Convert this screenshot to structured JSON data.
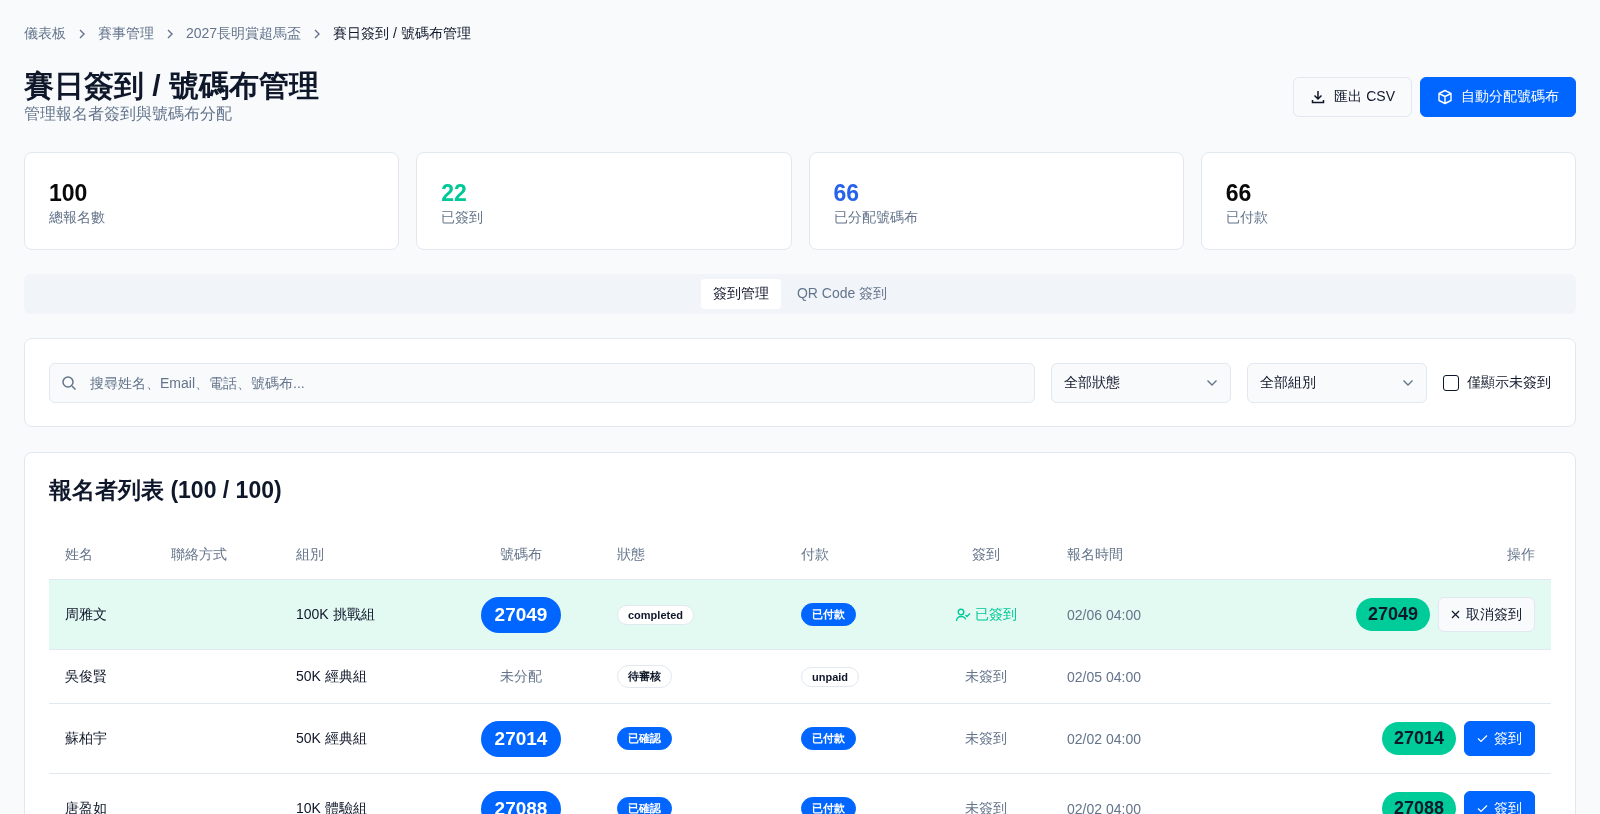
{
  "breadcrumbs": [
    {
      "label": "儀表板",
      "current": false
    },
    {
      "label": "賽事管理",
      "current": false
    },
    {
      "label": "2027長明賞超馬盃",
      "current": false
    },
    {
      "label": "賽日簽到 / 號碼布管理",
      "current": true
    }
  ],
  "header": {
    "title": "賽日簽到 / 號碼布管理",
    "subtitle": "管理報名者簽到與號碼布分配",
    "buttons": [
      {
        "kind": "export",
        "label": "匯出 CSV"
      },
      {
        "kind": "assign",
        "label": "自動分配號碼布"
      }
    ]
  },
  "stats": [
    {
      "value": "100",
      "label": "總報名數",
      "color": "#0a0a0a"
    },
    {
      "value": "22",
      "label": "已簽到",
      "color": "#00c896"
    },
    {
      "value": "66",
      "label": "已分配號碼布",
      "color": "#2563eb"
    },
    {
      "value": "66",
      "label": "已付款",
      "color": "#0a0a0a"
    }
  ],
  "tabs": [
    {
      "label": "簽到管理",
      "selected": true
    },
    {
      "label": "QR Code 簽到",
      "selected": false
    }
  ],
  "filters": {
    "search": {
      "placeholder": "搜尋姓名、Email、電話、號碼布..."
    },
    "selects": [
      "全部狀態",
      "全部組別"
    ],
    "checkbox": {
      "label": "僅顯示未簽到",
      "checked": false
    }
  },
  "table": {
    "title": "報名者列表 (100 / 100)",
    "columns": [
      "姓名",
      "聯絡方式",
      "組別",
      "號碼布",
      "狀態",
      "付款",
      "簽到",
      "報名時間",
      "操作"
    ],
    "rows": [
      {
        "name": "周雅文",
        "group": "100K 挑戰組",
        "bib": "27049",
        "bib_assigned": true,
        "status": {
          "label": "completed",
          "kind": "outline"
        },
        "payment": {
          "label": "已付款",
          "kind": "solid"
        },
        "checkin": "已簽到",
        "checked_in": true,
        "time": "02/06 04:00",
        "action": {
          "kind": "cancel",
          "bib": "27049",
          "label": "取消簽到"
        }
      },
      {
        "name": "吳俊賢",
        "group": "50K 經典組",
        "bib": "未分配",
        "bib_assigned": false,
        "status": {
          "label": "待審核",
          "kind": "outline"
        },
        "payment": {
          "label": "unpaid",
          "kind": "outline"
        },
        "checkin": "未簽到",
        "checked_in": false,
        "time": "02/05 04:00",
        "action": {
          "kind": "none"
        }
      },
      {
        "name": "蘇柏宇",
        "group": "50K 經典組",
        "bib": "27014",
        "bib_assigned": true,
        "status": {
          "label": "已確認",
          "kind": "solid"
        },
        "payment": {
          "label": "已付款",
          "kind": "solid"
        },
        "checkin": "未簽到",
        "checked_in": false,
        "time": "02/02 04:00",
        "action": {
          "kind": "checkin",
          "bib": "27014",
          "label": "簽到"
        }
      },
      {
        "name": "唐盈如",
        "group": "10K 體驗組",
        "bib": "27088",
        "bib_assigned": true,
        "status": {
          "label": "已確認",
          "kind": "solid"
        },
        "payment": {
          "label": "已付款",
          "kind": "solid"
        },
        "checkin": "未簽到",
        "checked_in": false,
        "time": "02/02 04:00",
        "action": {
          "kind": "checkin",
          "bib": "27088",
          "label": "簽到"
        }
      }
    ]
  }
}
